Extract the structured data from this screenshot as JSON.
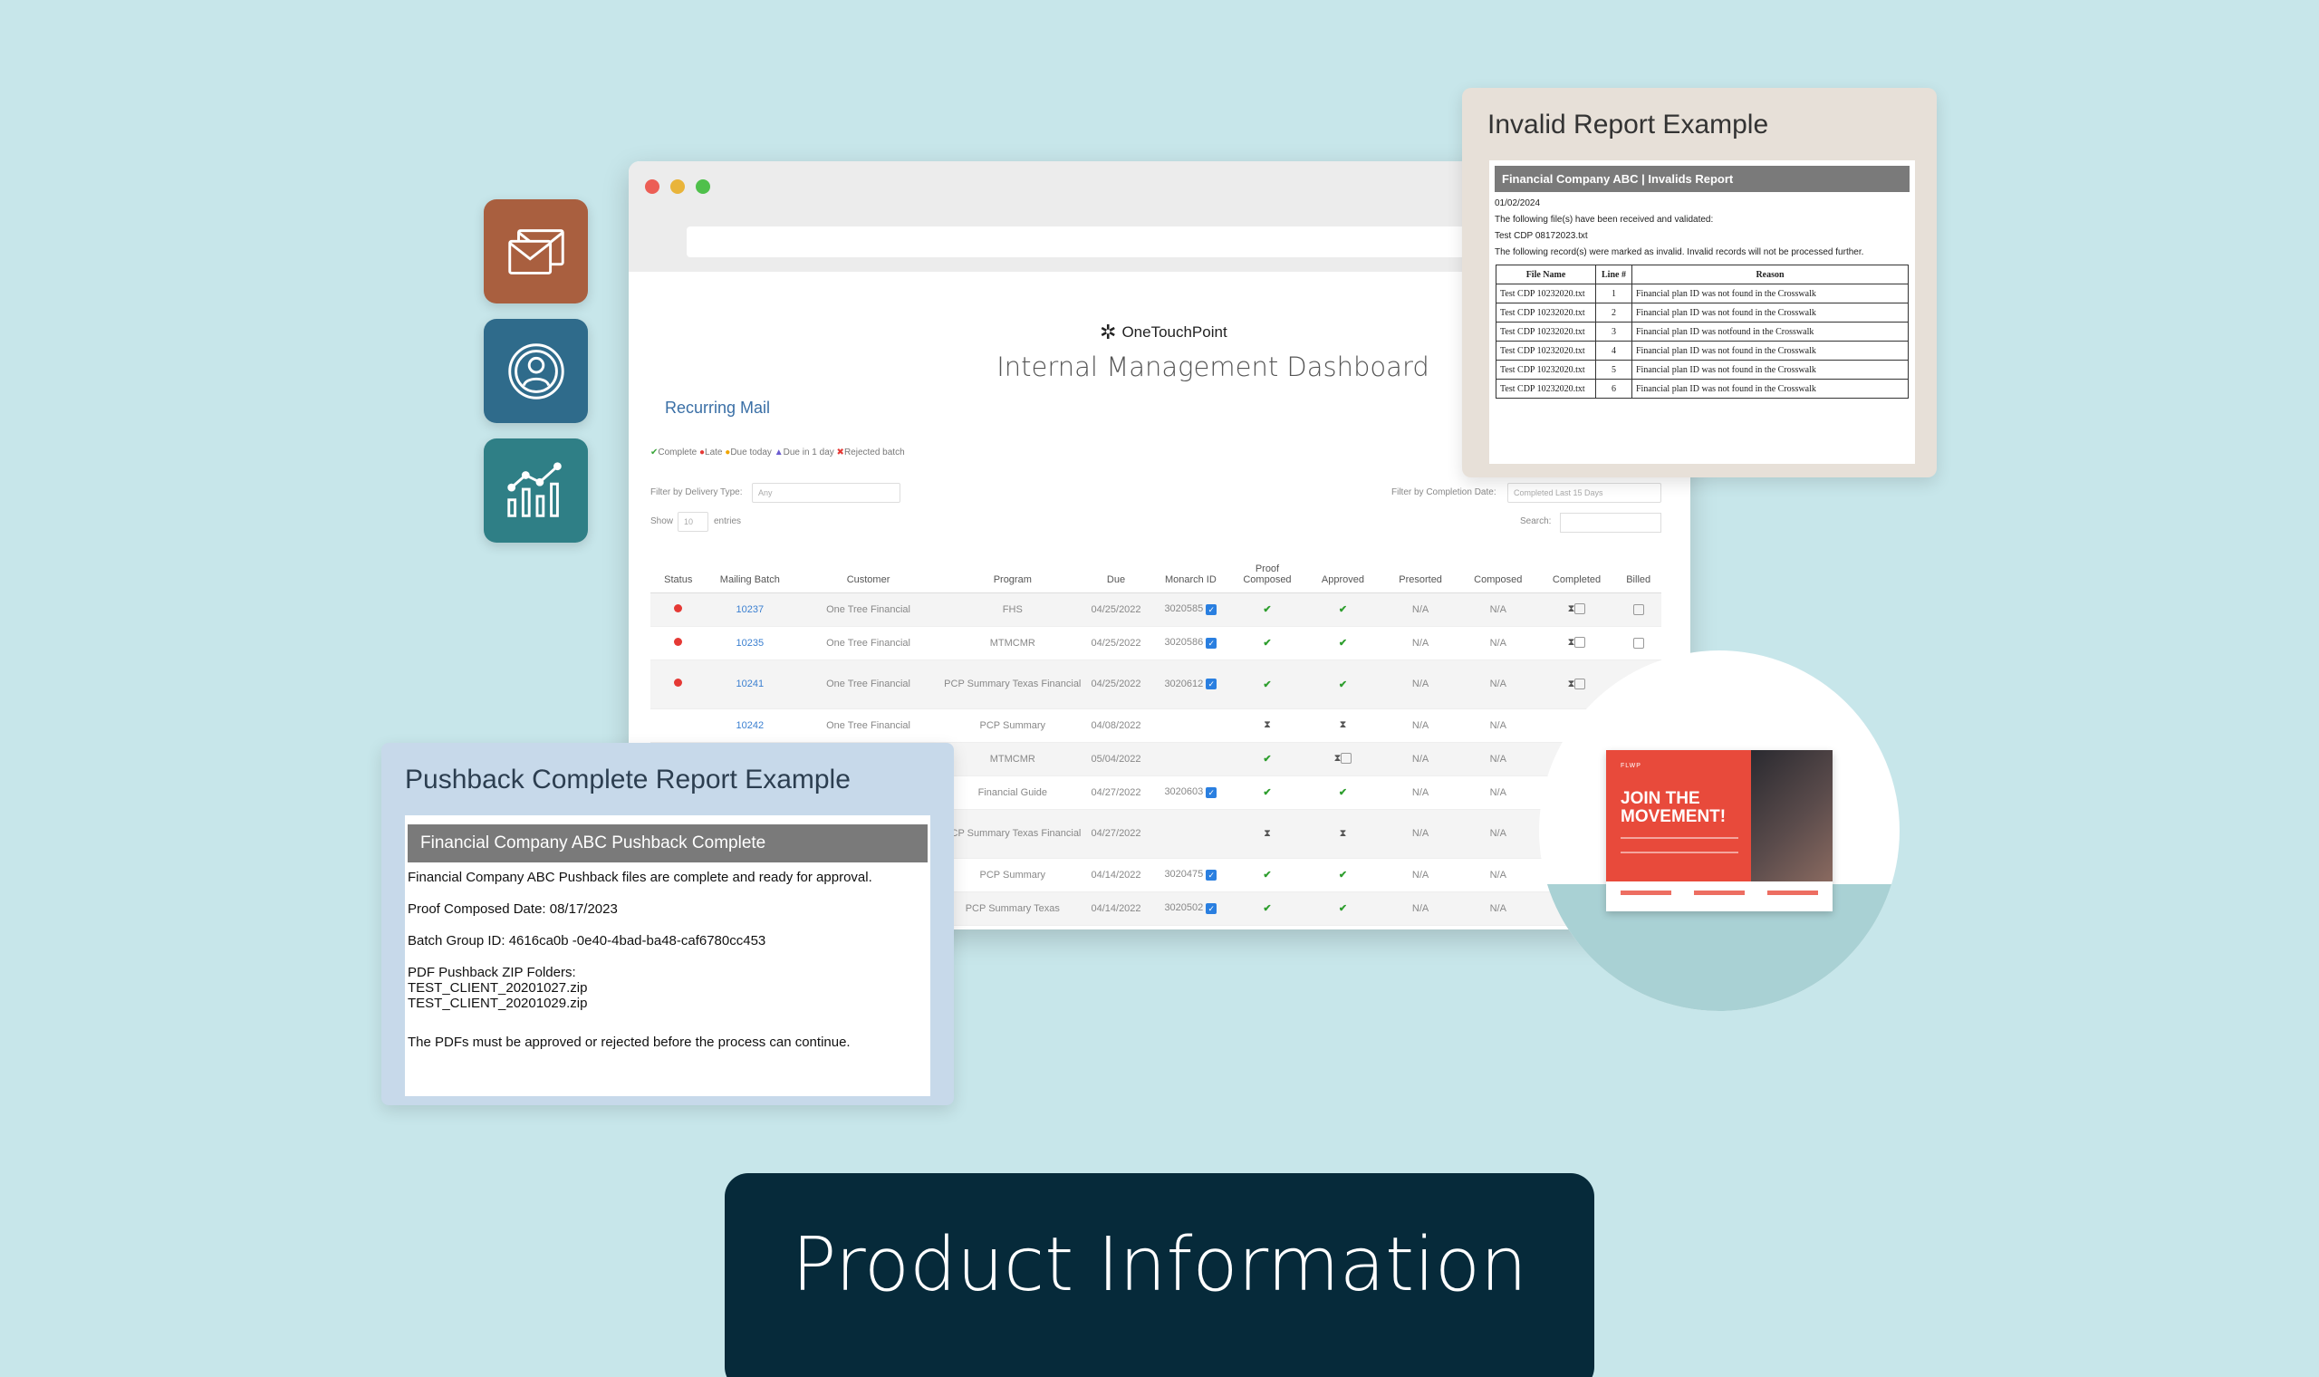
{
  "side_icons": {
    "mail": "envelope-icon",
    "support": "user-circle-icon",
    "analytics": "bar-line-chart-icon"
  },
  "dashboard": {
    "brand": "OneTouchPoint",
    "title": "Internal Management Dashboard",
    "section": "Recurring Mail",
    "legend": {
      "complete": "Complete",
      "late": "Late",
      "due_today": "Due today",
      "due_1day": "Due in 1 day",
      "rejected": "Rejected batch"
    },
    "filters": {
      "delivery_label": "Filter by Delivery Type:",
      "delivery_value": "Any",
      "completion_label": "Filter by Completion Date:",
      "completion_value": "Completed Last 15 Days",
      "show_label": "Show",
      "show_value": "10",
      "entries_label": "entries",
      "search_label": "Search:"
    },
    "columns": [
      "Status",
      "Mailing Batch",
      "Customer",
      "Program",
      "Due",
      "Monarch ID",
      "Proof Composed",
      "Approved",
      "Presorted",
      "Composed",
      "Completed",
      "Billed"
    ],
    "rows": [
      {
        "batch": "10237",
        "customer": "One Tree Financial",
        "program": "FHS",
        "due": "04/25/2022",
        "monarch": "3020585",
        "proof": "✔",
        "approved": "✔",
        "presorted": "N/A",
        "composed": "N/A"
      },
      {
        "batch": "10235",
        "customer": "One Tree Financial",
        "program": "MTMCMR",
        "due": "04/25/2022",
        "monarch": "3020586",
        "proof": "✔",
        "approved": "✔",
        "presorted": "N/A",
        "composed": "N/A"
      },
      {
        "batch": "10241",
        "customer": "One Tree Financial",
        "program": "PCP Summary Texas Financial",
        "due": "04/25/2022",
        "monarch": "3020612",
        "proof": "✔",
        "approved": "✔",
        "presorted": "N/A",
        "composed": "N/A"
      },
      {
        "batch": "10242",
        "customer": "One Tree Financial",
        "program": "PCP Summary",
        "due": "04/08/2022",
        "monarch": "",
        "proof": "⧗",
        "approved": "⧗",
        "presorted": "N/A",
        "composed": "N/A"
      },
      {
        "batch": "",
        "customer": "",
        "program": "MTMCMR",
        "due": "05/04/2022",
        "monarch": "",
        "proof": "✔",
        "approved": "⧗",
        "presorted": "N/A",
        "composed": "N/A"
      },
      {
        "batch": "",
        "customer": "",
        "program": "Financial Guide",
        "due": "04/27/2022",
        "monarch": "3020603",
        "proof": "✔",
        "approved": "✔",
        "presorted": "N/A",
        "composed": "N/A"
      },
      {
        "batch": "",
        "customer": "",
        "program": "PCP Summary Texas Financial",
        "due": "04/27/2022",
        "monarch": "",
        "proof": "⧗",
        "approved": "⧗",
        "presorted": "N/A",
        "composed": "N/A"
      },
      {
        "batch": "",
        "customer": "",
        "program": "PCP Summary",
        "due": "04/14/2022",
        "monarch": "3020475",
        "proof": "✔",
        "approved": "✔",
        "presorted": "N/A",
        "composed": "N/A"
      },
      {
        "batch": "",
        "customer": "",
        "program": "PCP Summary Texas",
        "due": "04/14/2022",
        "monarch": "3020502",
        "proof": "✔",
        "approved": "✔",
        "presorted": "N/A",
        "composed": "N/A"
      }
    ]
  },
  "invalid_report": {
    "card_title": "Invalid Report Example",
    "header": "Financial Company ABC | Invalids Report",
    "date": "01/02/2024",
    "received_text": "The following file(s) have been received and validated:",
    "file": "Test CDP 08172023.txt",
    "invalid_text": "The following record(s) were marked as invalid. Invalid records will not be processed further.",
    "columns": [
      "File Name",
      "Line #",
      "Reason"
    ],
    "rows": [
      {
        "file": "Test CDP 10232020.txt",
        "line": "1",
        "reason": "Financial plan ID was not found in the Crosswalk"
      },
      {
        "file": "Test CDP 10232020.txt",
        "line": "2",
        "reason": "Financial plan ID was not found in the Crosswalk"
      },
      {
        "file": "Test CDP 10232020.txt",
        "line": "3",
        "reason": "Financial plan ID was notfound in the Crosswalk"
      },
      {
        "file": "Test CDP 10232020.txt",
        "line": "4",
        "reason": "Financial plan ID was not found in the Crosswalk"
      },
      {
        "file": "Test CDP 10232020.txt",
        "line": "5",
        "reason": "Financial plan ID was not found in the Crosswalk"
      },
      {
        "file": "Test CDP 10232020.txt",
        "line": "6",
        "reason": "Financial plan ID was not found in the Crosswalk"
      }
    ]
  },
  "pushback_report": {
    "card_title": "Pushback Complete Report Example",
    "header": "Financial Company ABC Pushback Complete",
    "intro": "Financial Company ABC Pushback files are complete and ready for approval.",
    "proof_date": "Proof Composed Date: 08/17/2023",
    "batch_group": "Batch Group ID: 4616ca0b  -0e40-4bad-ba48-caf6780cc453",
    "zip_label": "PDF Pushback ZIP Folders:",
    "zip_1": "TEST_CLIENT_20201027.zip",
    "zip_2": "TEST_CLIENT_20201029.zip",
    "footer": "The PDFs must be approved or rejected before the process can continue."
  },
  "flyer": {
    "logo": "FLWP",
    "headline_1": "JOIN THE",
    "headline_2": "MOVEMENT!"
  },
  "banner": {
    "text": "Product Information"
  }
}
